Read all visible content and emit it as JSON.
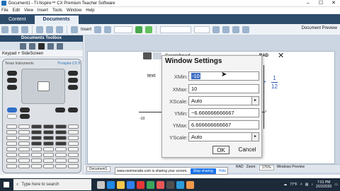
{
  "window": {
    "title": "Document1 - TI-Nspire™ CX Premium Teacher Software",
    "min": "–",
    "max": "☐",
    "close": "✕"
  },
  "menu": [
    "File",
    "Edit",
    "View",
    "Insert",
    "Tools",
    "Window",
    "Help"
  ],
  "tabs": {
    "content": "Content",
    "documents": "Documents"
  },
  "toolbar": {
    "insert_label": "Insert",
    "doc_preview_label": "Document Preview"
  },
  "side_panel": {
    "title": "Documents Toolbox",
    "keypad_select": "Keypad + SideScreen",
    "brand": "Texas Instruments",
    "model": "TI-nspire CX II"
  },
  "calc_page": {
    "tab_title": "Scratchpad",
    "angle_mode": "RAD",
    "axis_label": "text",
    "axis_min": "-10",
    "fraction_num": "1",
    "fraction_den": "12"
  },
  "dialog": {
    "title": "Window Settings",
    "fields": [
      {
        "label": "XMin:",
        "value": "-10"
      },
      {
        "label": "XMax:",
        "value": "10"
      },
      {
        "label": "XScale:",
        "value": "Auto"
      },
      {
        "label": "YMin:",
        "value": "−6.666666666667"
      },
      {
        "label": "YMax:",
        "value": "6.666666666667"
      },
      {
        "label": "YScale:",
        "value": "Auto"
      }
    ],
    "ok": "OK",
    "cancel": "Cancel"
  },
  "status": {
    "doc_tab": "Document1",
    "share_text": "www.noomerade.com is sharing your screen.",
    "stop_sharing": "Stop sharing",
    "hide": "Hide",
    "mode": "RAD",
    "zoom_label": "Zoom:",
    "zoom_value": "175%",
    "preview": "Windows Preview"
  },
  "taskbar": {
    "search_placeholder": "Type here to search",
    "temperature": "77°F",
    "time": "7:01 PM",
    "date": "2/22/2020"
  }
}
